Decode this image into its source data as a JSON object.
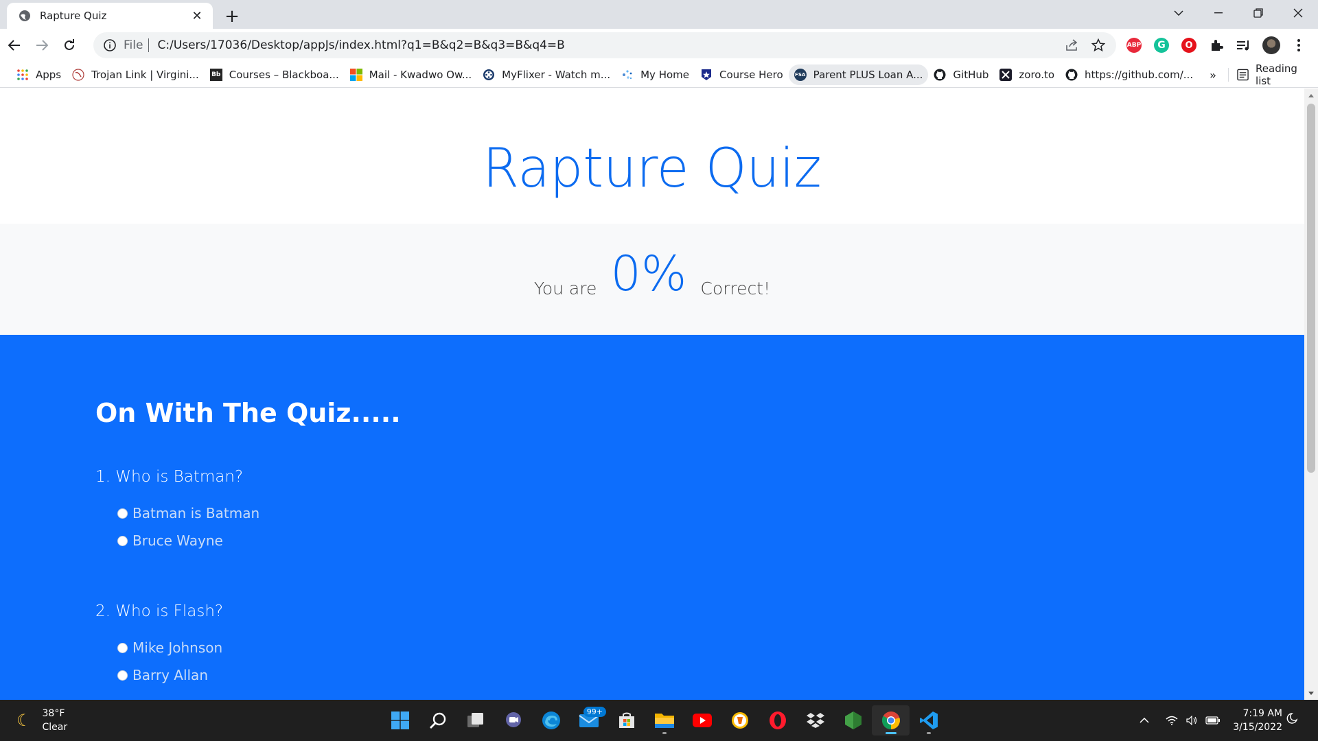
{
  "browser": {
    "tab_title": "Rapture Quiz",
    "tab_close": "✕",
    "new_tab": "+",
    "url_scheme": "File",
    "url": "C:/Users/17036/Desktop/appJs/index.html?q1=B&q2=B&q3=B&q4=B",
    "bookmarks": [
      {
        "label": "Apps",
        "icon": "apps-grid-icon"
      },
      {
        "label": "Trojan Link | Virgini...",
        "icon": "trojan-icon"
      },
      {
        "label": "Courses – Blackboa...",
        "icon": "blackboard-icon",
        "icon_text": "Bb"
      },
      {
        "label": "Mail - Kwadwo Ow...",
        "icon": "microsoft-icon"
      },
      {
        "label": "MyFlixer - Watch m...",
        "icon": "film-reel-icon"
      },
      {
        "label": "My Home",
        "icon": "sparkle-icon"
      },
      {
        "label": "Course Hero",
        "icon": "star-shield-icon"
      },
      {
        "label": "Parent PLUS Loan A...",
        "icon": "fsa-icon",
        "icon_text": "FSA"
      },
      {
        "label": "GitHub",
        "icon": "github-icon"
      },
      {
        "label": "zoro.to",
        "icon": "zoro-icon"
      },
      {
        "label": "https://github.com/...",
        "icon": "github-icon"
      }
    ],
    "bookmarks_more": "»",
    "reading_list": "Reading list",
    "ext_abp": "ABP"
  },
  "page": {
    "title": "Rapture Quiz",
    "result_pre": "You are",
    "result_score": "0%",
    "result_post": "Correct!",
    "quiz_heading": "On With The Quiz.....",
    "questions": [
      {
        "text": "1. Who is Batman?",
        "options": [
          "Batman is Batman",
          "Bruce Wayne"
        ]
      },
      {
        "text": "2. Who is Flash?",
        "options": [
          "Mike Johnson",
          "Barry Allan"
        ]
      }
    ]
  },
  "taskbar": {
    "temperature": "38°F",
    "weather": "Clear",
    "mail_badge": "99+",
    "time": "7:19 AM",
    "date": "3/15/2022"
  },
  "colors": {
    "accent": "#0d6efd",
    "title_blue": "#0c6bf0"
  }
}
